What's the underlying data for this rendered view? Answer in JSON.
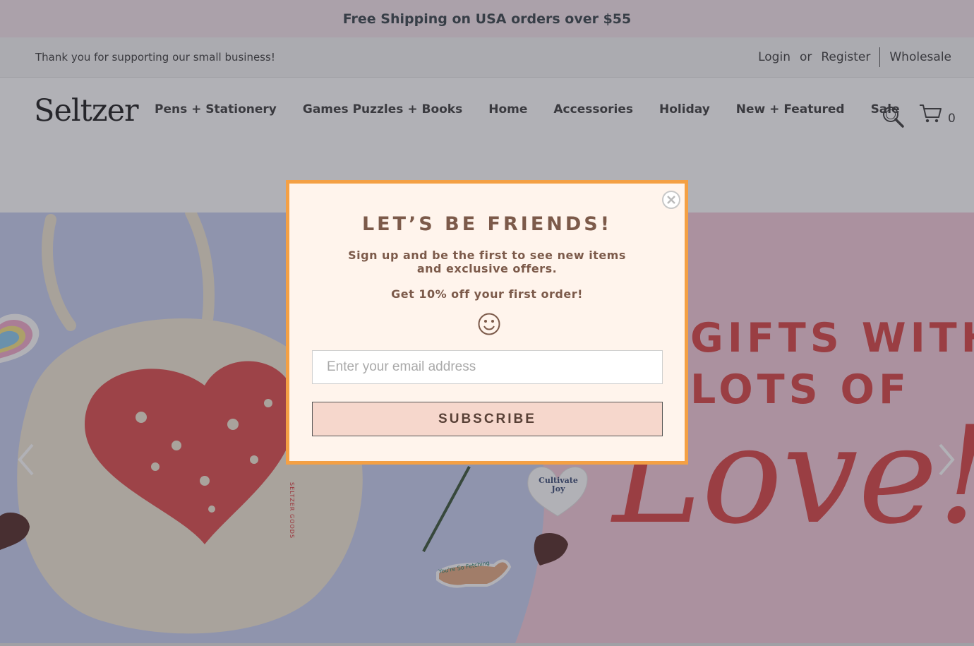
{
  "announcement": {
    "text": "Free Shipping on USA orders over $55"
  },
  "topbar": {
    "thanks": "Thank you for supporting our small business!",
    "login": "Login",
    "or": "or",
    "register": "Register",
    "wholesale": "Wholesale"
  },
  "header": {
    "logo": "Seltzer",
    "nav": [
      "Pens + Stationery",
      "Games Puzzles + Books",
      "Home",
      "Accessories",
      "Holiday",
      "New + Featured",
      "Sale"
    ],
    "cart_count": "0"
  },
  "hero": {
    "headline_line1": "GIFTS WITH",
    "headline_line2": "LOTS OF",
    "script": "Love!",
    "tote_brand": "SELTZER GOODS",
    "sticker": "Cultivate Joy",
    "dog_sticker": "You're So Fetching",
    "colors": {
      "left_bg": "#c5cdf0",
      "right_bg": "#f5c9d8",
      "accent_red": "#d83a3a"
    }
  },
  "modal": {
    "title": "LET’S BE FRIENDS!",
    "subtitle": "Sign up and be the first to see new items and exclusive offers.",
    "offer": "Get 10% off your first order!",
    "email_placeholder": "Enter your email address",
    "subscribe": "SUBSCRIBE",
    "colors": {
      "border": "#f4a044",
      "background": "#fff4ec",
      "button": "#f6d7cc",
      "text": "#7c5a4a"
    }
  }
}
